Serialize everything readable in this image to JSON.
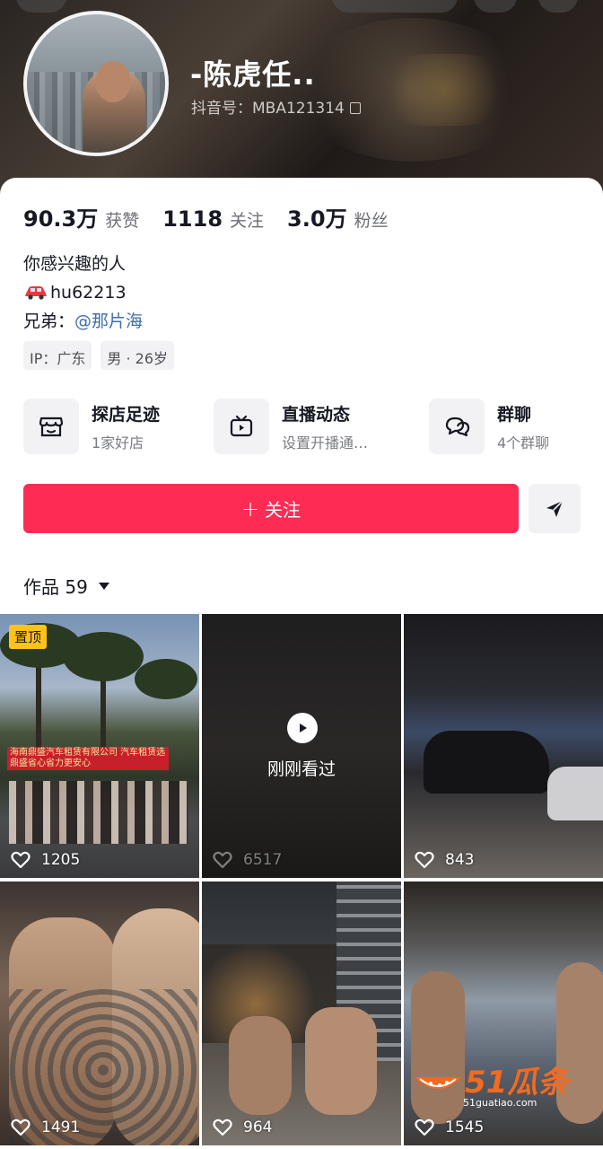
{
  "profile": {
    "name": "-陈虎任..",
    "douyin_id": "抖音号：MBA121314"
  },
  "stats": [
    {
      "num": "90.3万",
      "label": "获赞"
    },
    {
      "num": "1118",
      "label": "关注"
    },
    {
      "num": "3.0万",
      "label": "粉丝"
    }
  ],
  "bio": {
    "line1": "你感兴趣的人",
    "line2": "hu62213",
    "line3_prefix": "兄弟：",
    "line3_mention": "@那片海"
  },
  "tags": [
    "IP：广东",
    "男 · 26岁"
  ],
  "features": [
    {
      "title": "探店足迹",
      "subtitle": "1家好店",
      "icon": "shop-icon"
    },
    {
      "title": "直播动态",
      "subtitle": "设置开播通…",
      "icon": "tv-icon"
    },
    {
      "title": "群聊",
      "subtitle": "4个群聊",
      "icon": "chat-icon"
    }
  ],
  "actions": {
    "follow_label": "关注",
    "follow_plus": "+"
  },
  "works": {
    "label": "作品 59"
  },
  "videos": [
    {
      "likes": "1205",
      "pinned": "置顶",
      "banner": "海南鼎盛汽车租赁有限公司 汽车租赁选鼎盛省心省力更安心"
    },
    {
      "likes": "6517",
      "overlay": "刚刚看过"
    },
    {
      "likes": "843"
    },
    {
      "likes": "1491"
    },
    {
      "likes": "964"
    },
    {
      "likes": "1545"
    }
  ],
  "watermark": {
    "logo": "51瓜条",
    "url": "51guatiao.com"
  },
  "colors": {
    "accent": "#fe2c55",
    "mention": "#3e6ea8",
    "pin": "#ffc21a"
  }
}
